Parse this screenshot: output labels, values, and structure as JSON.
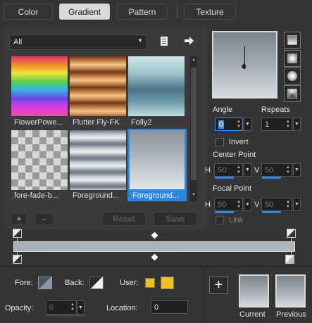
{
  "tabs": [
    {
      "label": "Color"
    },
    {
      "label": "Gradient"
    },
    {
      "label": "Pattern"
    },
    {
      "label": "Texture"
    }
  ],
  "library": {
    "dropdown_value": "All",
    "items": [
      {
        "label": "FlowerPowe..."
      },
      {
        "label": "Flutter Fly-FK"
      },
      {
        "label": "Folly2"
      },
      {
        "label": "fore-fade-b..."
      },
      {
        "label": "Foreground..."
      },
      {
        "label": "Foreground..."
      }
    ],
    "selected_index": 5,
    "add_label": "+",
    "remove_label": "-",
    "reset_label": "Reset",
    "save_label": "Save"
  },
  "settings": {
    "angle_label": "Angle",
    "angle_value": "0",
    "repeats_label": "Repeats",
    "repeats_value": "1",
    "invert_label": "Invert",
    "center_point_label": "Center Point",
    "center_h_label": "H",
    "center_h_value": "50",
    "center_v_label": "V",
    "center_v_value": "50",
    "focal_point_label": "Focal Point",
    "focal_h_label": "H",
    "focal_h_value": "50",
    "focal_v_label": "V",
    "focal_v_value": "50",
    "link_label": "Link"
  },
  "footer": {
    "fore_label": "Fore:",
    "back_label": "Back:",
    "user_label": "User:",
    "user_color": "#f0c020",
    "opacity_label": "Opacity:",
    "opacity_value": "0",
    "location_label": "Location:",
    "location_value": "0",
    "add_label": "+",
    "current_label": "Current",
    "previous_label": "Previous"
  }
}
